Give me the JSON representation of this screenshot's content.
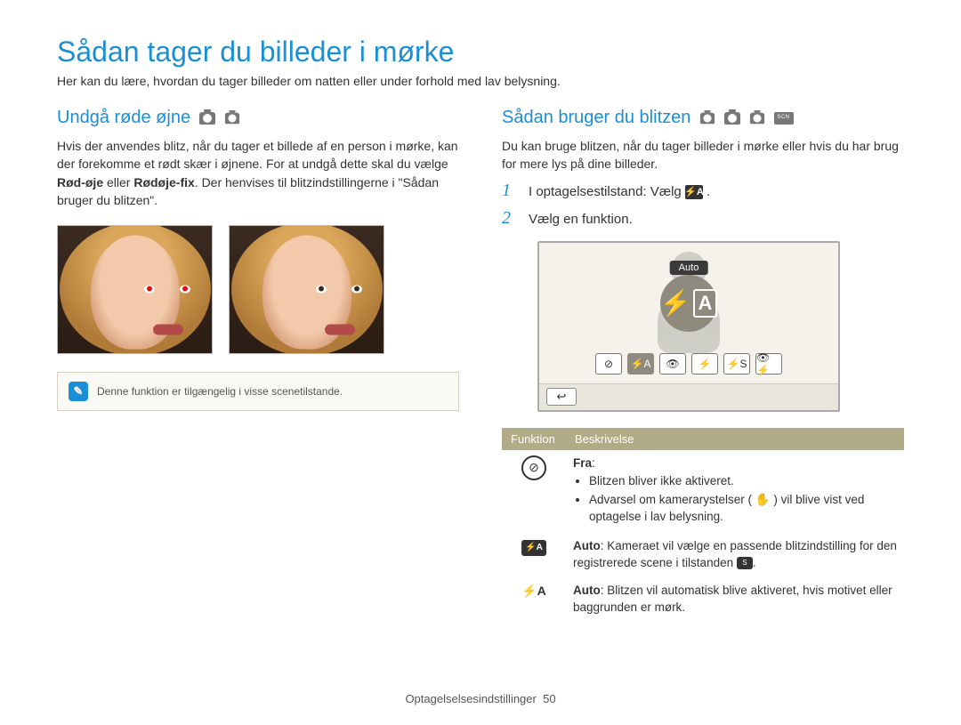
{
  "page": {
    "title": "Sådan tager du billeder i mørke",
    "subtitle": "Her kan du lære, hvordan du tager billeder om natten eller under forhold med lav belysning."
  },
  "left": {
    "heading": "Undgå røde øjne",
    "body_pre": "Hvis der anvendes blitz, når du tager et billede af en person i mørke, kan der forekomme et rødt skær i øjnene. For at undgå dette skal du vælge ",
    "bold1": "Rød-øje",
    "mid": " eller ",
    "bold2": "Rødøje-fix",
    "body_post": ". Der henvises til blitzindstillingerne i \"Sådan bruger du blitzen\".",
    "note": "Denne funktion er tilgængelig i visse scenetilstande."
  },
  "right": {
    "heading": "Sådan bruger du blitzen",
    "intro": "Du kan bruge blitzen, når du tager billeder i mørke eller hvis du har brug for mere lys på dine billeder.",
    "steps": [
      {
        "num": "1",
        "text_pre": "I optagelsestilstand: Vælg ",
        "icon": "⚡A",
        "text_post": "."
      },
      {
        "num": "2",
        "text_pre": "Vælg en funktion.",
        "icon": "",
        "text_post": ""
      }
    ],
    "screen": {
      "label": "Auto",
      "big_icon": {
        "bolt": "⚡",
        "letter": "A"
      },
      "options": [
        "⊘",
        "⚡A",
        "👁",
        "⚡",
        "⚡S",
        "👁⚡"
      ],
      "selected_index": 1,
      "back": "↩"
    },
    "table": {
      "headers": [
        "Funktion",
        "Beskrivelse"
      ],
      "rows": [
        {
          "icon_type": "circle-slash",
          "icon_text": "⊘",
          "title": "Fra",
          "bullets": [
            "Blitzen bliver ikke aktiveret.",
            "Advarsel om kamerarystelser ( ✋ ) vil blive vist ved optagelse i lav belysning."
          ]
        },
        {
          "icon_type": "badge",
          "icon_text": "⚡A",
          "title": "Auto",
          "desc_pre": ": Kameraet vil vælge en passende blitzindstilling for den registrerede scene i tilstanden ",
          "desc_post": "."
        },
        {
          "icon_type": "plain",
          "icon_text": "⚡A",
          "title": "Auto",
          "desc": ": Blitzen vil automatisk blive aktiveret, hvis motivet eller baggrunden er mørk."
        }
      ]
    }
  },
  "footer": {
    "section": "Optagelselsesindstillinger",
    "page": "50"
  }
}
